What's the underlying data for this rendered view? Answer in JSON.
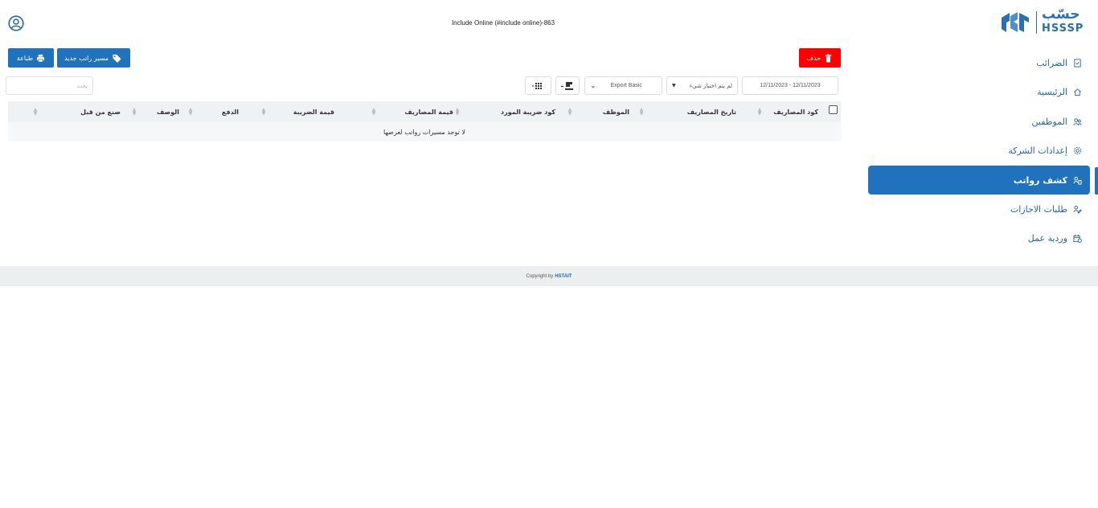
{
  "header": {
    "title": "Include Online (#include online)-863"
  },
  "brand": {
    "logo_arabic": "حسّب",
    "logo_latin": "HSSSP",
    "accent_color": "#1f72bb"
  },
  "sidebar": {
    "items": [
      {
        "label": "الضرائب",
        "icon": "tax-document-icon"
      },
      {
        "label": "الرئيسية",
        "icon": "home-icon"
      },
      {
        "label": "الموظفين",
        "icon": "users-icon"
      },
      {
        "label": "إعدادات الشركة",
        "icon": "company-settings-icon"
      },
      {
        "label": "كشف رواتب",
        "icon": "payroll-icon",
        "active": true
      },
      {
        "label": "طلبات الاجازات",
        "icon": "leave-requests-icon"
      },
      {
        "label": "وردية عمل",
        "icon": "shift-calendar-icon"
      }
    ]
  },
  "toolbar": {
    "print_label": "طباعة",
    "new_payslip_label": "مسير راتب جديد",
    "delete_label": "حذف",
    "search_placeholder": "بحث",
    "export_label": "Export Basic",
    "choose_placeholder": "لم يتم اختيار شيء",
    "date_range": "12/11/2023 - 12/11/2023"
  },
  "table": {
    "columns": [
      "كود المصاريف",
      "تاريخ المصاريف",
      "الموظف",
      "كود ضريبة المورد",
      "قيمة المصاريف",
      "قيمة الضريبة",
      "الدفع",
      "الوصف",
      "صنع من قبل"
    ],
    "empty_message": "لا توجد مسيرات رواتب لعرضها"
  },
  "footer": {
    "copyright": "Copyright by",
    "company": "HSTAIT"
  }
}
